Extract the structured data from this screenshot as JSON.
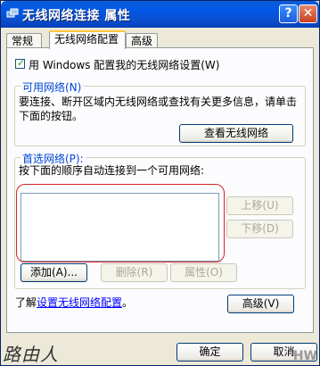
{
  "window": {
    "title": "无线网络连接 属性",
    "help_label": "?",
    "close_label": "✕"
  },
  "tabs": [
    {
      "label": "常规"
    },
    {
      "label": "无线网络配置"
    },
    {
      "label": "高级"
    }
  ],
  "wireless_config": {
    "use_windows_label": "用 Windows 配置我的无线网络设置(W)",
    "use_windows_checked": true,
    "available": {
      "title": "可用网络(N)",
      "description": "要连接、断开区域内无线网络或查找有关更多信息，请单击下面的按钮。",
      "view_button": "查看无线网络"
    },
    "preferred": {
      "title": "首选网络(P):",
      "description": "按下面的顺序自动连接到一个可用网络:",
      "move_up": "上移(U)",
      "move_down": "下移(D)",
      "add": "添加(A)...",
      "remove": "删除(R)",
      "properties": "属性(O)"
    },
    "learn_prefix": "了解",
    "learn_link": "设置无线网络配置",
    "learn_suffix": "。",
    "advanced_button": "高级(V)"
  },
  "footer": {
    "ok": "确定",
    "cancel": "取消"
  },
  "watermark": {
    "left": "路由人",
    "right": "HW"
  },
  "colors": {
    "titlebar": "#0058E6",
    "dialog_bg": "#ECE9D8",
    "link": "#0000FF",
    "group_title": "#0046D5",
    "highlight": "#D8232A"
  }
}
